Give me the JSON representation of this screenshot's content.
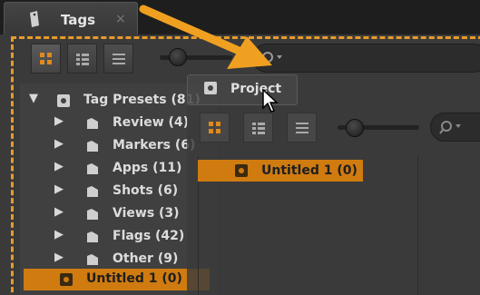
{
  "window": {
    "tab_title": "Tags",
    "tab_close": "×",
    "accent_color": "#cf7b10",
    "drop_outline_color": "#e79a2a"
  },
  "toolbar": {
    "view_buttons": [
      "grid-view",
      "list-detail-view",
      "list-view"
    ],
    "active_view": "grid-view",
    "search": {
      "value": "",
      "placeholder": ""
    }
  },
  "tree": {
    "root": {
      "label": "Tag Presets (81)",
      "expanded": true
    },
    "items": [
      {
        "label": "Review (4)"
      },
      {
        "label": "Markers (6)"
      },
      {
        "label": "Apps (11)"
      },
      {
        "label": "Shots (6)"
      },
      {
        "label": "Views (3)"
      },
      {
        "label": "Flags (42)"
      },
      {
        "label": "Other (9)"
      }
    ],
    "selected": {
      "label": "Untitled 1 (0)"
    }
  },
  "drag": {
    "tab_label": "Project",
    "selected_label": "Untitled 1 (0)"
  }
}
